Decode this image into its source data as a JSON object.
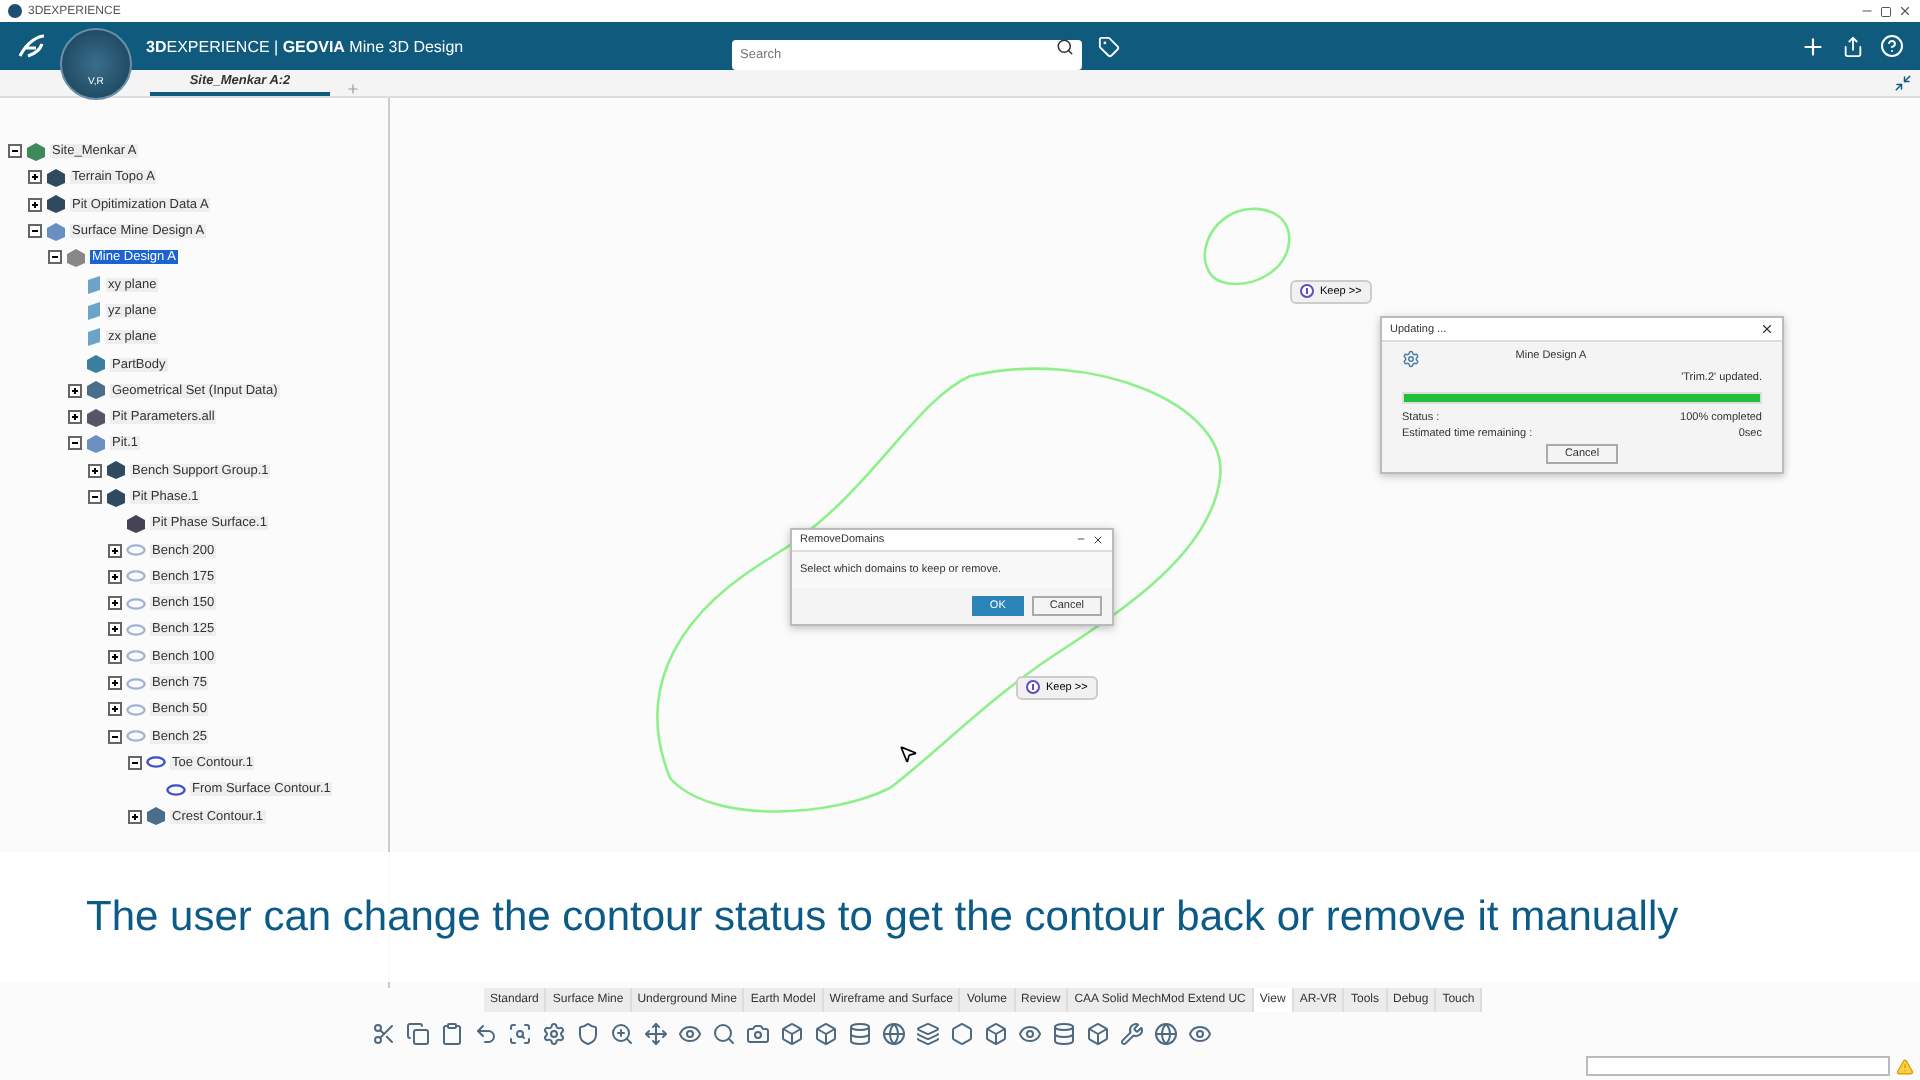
{
  "window": {
    "title": "3DEXPERIENCE"
  },
  "top_bar": {
    "compass_label": "V,R",
    "title": "**3D**EXPERIENCE | **GEOVIA** Mine 3D Design",
    "search": {
      "placeholder": "Search"
    }
  },
  "doc_tabs": [
    {
      "label": "Site_Menkar A:2",
      "selected": true
    }
  ],
  "tree": [
    {
      "label": "Site_Menkar A",
      "kind": "product",
      "expanded": true,
      "selected": false,
      "children": [
        {
          "label": "Terrain Topo A",
          "kind": "topo",
          "expanded": false,
          "selected": false
        },
        {
          "label": "Pit Opitimization Data A",
          "kind": "topo",
          "expanded": false,
          "selected": false
        },
        {
          "label": "Surface Mine Design A",
          "kind": "pit",
          "expanded": true,
          "selected": false,
          "children": [
            {
              "label": "Mine Design A",
              "kind": "part",
              "expanded": true,
              "selected": true,
              "children": [
                {
                  "label": "xy plane",
                  "kind": "plane",
                  "selected": false
                },
                {
                  "label": "yz plane",
                  "kind": "plane",
                  "selected": false
                },
                {
                  "label": "zx plane",
                  "kind": "plane",
                  "selected": false
                },
                {
                  "label": "PartBody",
                  "kind": "body",
                  "selected": false
                },
                {
                  "label": "Geometrical Set (Input Data)",
                  "kind": "geoset",
                  "expanded": false,
                  "selected": false
                },
                {
                  "label": "Pit Parameters.all",
                  "kind": "params",
                  "expanded": false,
                  "selected": false
                },
                {
                  "label": "Pit.1",
                  "kind": "pit",
                  "expanded": true,
                  "selected": false,
                  "children": [
                    {
                      "label": "Bench Support Group.1",
                      "kind": "topo",
                      "expanded": false,
                      "selected": false
                    },
                    {
                      "label": "Pit Phase.1",
                      "kind": "topo",
                      "expanded": true,
                      "selected": false,
                      "children": [
                        {
                          "label": "Pit Phase Surface.1",
                          "kind": "surface",
                          "selected": false
                        },
                        {
                          "label": "Bench 200",
                          "kind": "bench",
                          "expanded": false,
                          "selected": false
                        },
                        {
                          "label": "Bench 175",
                          "kind": "bench",
                          "expanded": false,
                          "selected": false
                        },
                        {
                          "label": "Bench 150",
                          "kind": "bench",
                          "expanded": false,
                          "selected": false
                        },
                        {
                          "label": "Bench 125",
                          "kind": "bench",
                          "expanded": false,
                          "selected": false
                        },
                        {
                          "label": "Bench 100",
                          "kind": "bench",
                          "expanded": false,
                          "selected": false
                        },
                        {
                          "label": "Bench 75",
                          "kind": "bench",
                          "expanded": false,
                          "selected": false
                        },
                        {
                          "label": "Bench 50",
                          "kind": "bench",
                          "expanded": false,
                          "selected": false
                        },
                        {
                          "label": "Bench 25",
                          "kind": "bench",
                          "expanded": true,
                          "selected": false,
                          "children": [
                            {
                              "label": "Toe Contour.1",
                              "kind": "contour",
                              "expanded": true,
                              "selected": false,
                              "children": [
                                {
                                  "label": "From Surface Contour.1",
                                  "kind": "contour",
                                  "selected": false
                                }
                              ]
                            },
                            {
                              "label": "Crest Contour.1",
                              "kind": "geoset",
                              "expanded": false,
                              "selected": false
                            }
                          ]
                        }
                      ]
                    }
                  ]
                }
              ]
            }
          ]
        }
      ]
    }
  ],
  "keep_tags": [
    "Keep >>",
    "Keep >>"
  ],
  "updating_dialog": {
    "title": "Updating ...",
    "object": "Mine Design A",
    "message": "'Trim.2' updated.",
    "level": 1,
    "status_label": "Status :",
    "status_value": "100% completed",
    "time_label": "Estimated time remaining :",
    "time_value": "0sec",
    "button": "Cancel"
  },
  "remove_dialog": {
    "title": "RemoveDomains",
    "message": "Select which domains to keep or remove.",
    "buttons": [
      "OK",
      "Cancel"
    ]
  },
  "caption": "The user can change the contour status to get the contour back or remove it manually",
  "toolbar_tabs": [
    {
      "label": "Standard",
      "selected": false
    },
    {
      "label": "Surface Mine",
      "selected": false
    },
    {
      "label": "Underground Mine",
      "selected": false
    },
    {
      "label": "Earth Model",
      "selected": false
    },
    {
      "label": "Wireframe and Surface",
      "selected": false
    },
    {
      "label": "Volume",
      "selected": false
    },
    {
      "label": "Review",
      "selected": false
    },
    {
      "label": "CAA Solid MechMod Extend UC",
      "selected": false
    },
    {
      "label": "View",
      "selected": true
    },
    {
      "label": "AR-VR",
      "selected": false
    },
    {
      "label": "Tools",
      "selected": false
    },
    {
      "label": "Debug",
      "selected": false
    },
    {
      "label": "Touch",
      "selected": false
    }
  ]
}
